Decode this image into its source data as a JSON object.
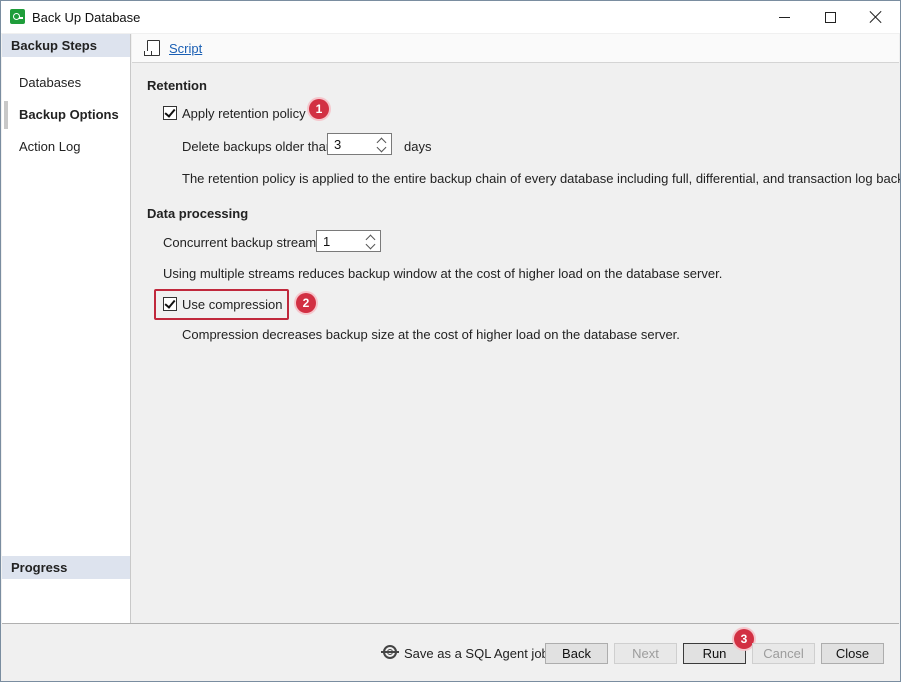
{
  "window": {
    "title": "Back Up Database"
  },
  "sidebar": {
    "steps_header": "Backup Steps",
    "items": [
      {
        "label": "Databases",
        "selected": false
      },
      {
        "label": "Backup Options",
        "selected": true
      },
      {
        "label": "Action Log",
        "selected": false
      }
    ],
    "progress_header": "Progress"
  },
  "toolbar": {
    "script_label": "Script"
  },
  "retention": {
    "title": "Retention",
    "apply_label": "Apply retention policy",
    "apply_checked": true,
    "delete_label": "Delete backups older than:",
    "delete_value": "3",
    "delete_unit": "days",
    "note": "The retention policy is applied to the entire backup chain of every database including full, differential, and transaction log backups."
  },
  "processing": {
    "title": "Data processing",
    "streams_label": "Concurrent backup streams:",
    "streams_value": "1",
    "streams_note": "Using multiple streams reduces backup window at the cost of higher load on the database server.",
    "compression_label": "Use compression",
    "compression_checked": true,
    "compression_note": "Compression decreases backup size at the cost of higher load on the database server."
  },
  "callouts": {
    "one": "1",
    "two": "2",
    "three": "3"
  },
  "footer": {
    "save_job_label": "Save as a SQL Agent job",
    "back": "Back",
    "next": "Next",
    "run": "Run",
    "cancel": "Cancel",
    "close": "Close"
  },
  "colors": {
    "accent_red": "#d23043",
    "link_blue": "#1a5fb4",
    "header_bg": "#dde3ee"
  }
}
